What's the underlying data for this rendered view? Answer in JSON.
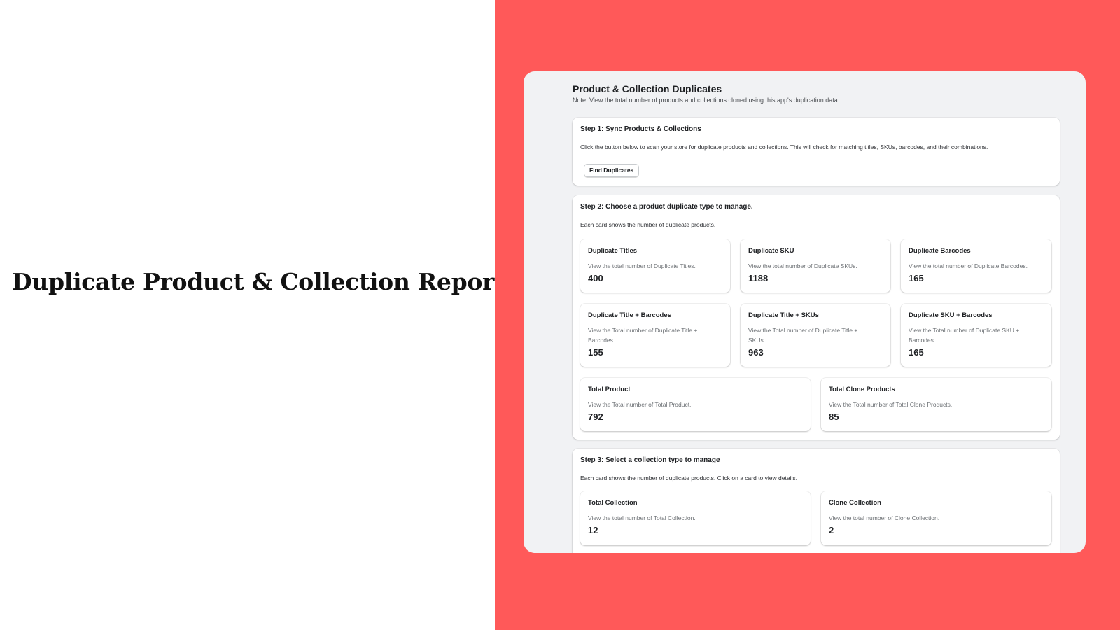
{
  "headline": "Duplicate Product & Collection Reports",
  "colors": {
    "accent_background": "#ff5959",
    "app_background": "#f1f2f4"
  },
  "page": {
    "title": "Product & Collection Duplicates",
    "note": "Note: View the total number of products and collections cloned using this app's duplication data."
  },
  "step1": {
    "title": "Step 1: Sync Products & Collections",
    "description": "Click the button below to scan your store for duplicate products and collections. This will check for matching titles, SKUs, barcodes, and their combinations.",
    "button_label": "Find Duplicates"
  },
  "step2": {
    "title": "Step 2: Choose a product duplicate type to manage.",
    "description": "Each card shows the number of duplicate products.",
    "cards": [
      {
        "title": "Duplicate Titles",
        "description": "View the total number of Duplicate Titles.",
        "value": "400"
      },
      {
        "title": "Duplicate SKU",
        "description": "View the total number of Duplicate SKUs.",
        "value": "1188"
      },
      {
        "title": "Duplicate Barcodes",
        "description": "View the total number of Duplicate Barcodes.",
        "value": "165"
      },
      {
        "title": "Duplicate Title + Barcodes",
        "description": "View the Total number of Duplicate Title + Barcodes.",
        "value": "155"
      },
      {
        "title": "Duplicate Title + SKUs",
        "description": "View the Total number of Duplicate Title + SKUs.",
        "value": "963"
      },
      {
        "title": "Duplicate SKU + Barcodes",
        "description": "View the Total number of Duplicate SKU + Barcodes.",
        "value": "165"
      },
      {
        "title": "Total Product",
        "description": "View the Total number of Total Product.",
        "value": "792"
      },
      {
        "title": "Total Clone Products",
        "description": "View the Total number of Total Clone Products.",
        "value": "85"
      }
    ]
  },
  "step3": {
    "title": "Step 3: Select a collection type to manage",
    "description": "Each card shows the number of duplicate products. Click on a card to view details.",
    "cards": [
      {
        "title": "Total Collection",
        "description": "View the total number of Total Collection.",
        "value": "12"
      },
      {
        "title": "Clone Collection",
        "description": "View the total number of Clone Collection.",
        "value": "2"
      }
    ]
  }
}
